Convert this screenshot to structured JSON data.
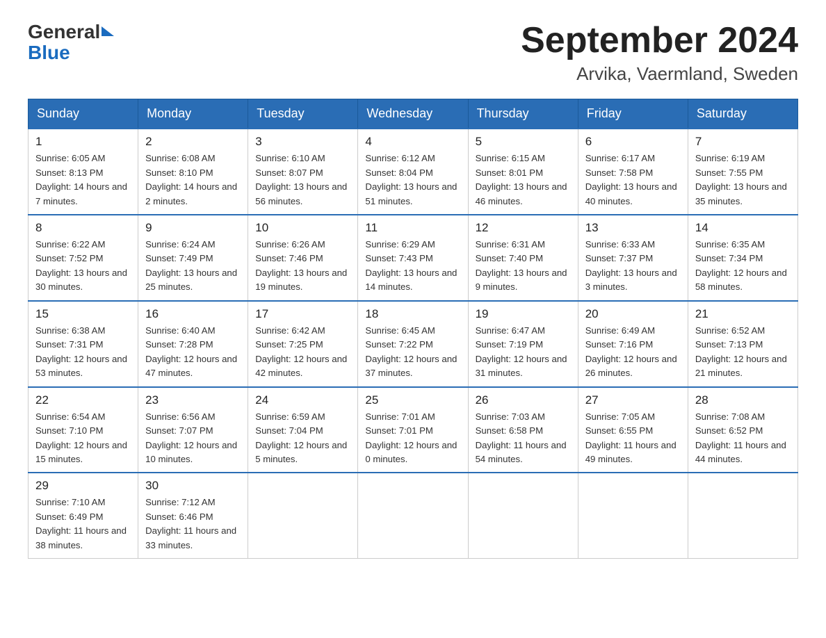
{
  "logo": {
    "text_general": "General",
    "text_blue": "Blue",
    "aria": "GeneralBlue logo"
  },
  "header": {
    "month_year": "September 2024",
    "location": "Arvika, Vaermland, Sweden"
  },
  "weekdays": [
    "Sunday",
    "Monday",
    "Tuesday",
    "Wednesday",
    "Thursday",
    "Friday",
    "Saturday"
  ],
  "weeks": [
    [
      {
        "day": "1",
        "sunrise": "6:05 AM",
        "sunset": "8:13 PM",
        "daylight": "14 hours and 7 minutes."
      },
      {
        "day": "2",
        "sunrise": "6:08 AM",
        "sunset": "8:10 PM",
        "daylight": "14 hours and 2 minutes."
      },
      {
        "day": "3",
        "sunrise": "6:10 AM",
        "sunset": "8:07 PM",
        "daylight": "13 hours and 56 minutes."
      },
      {
        "day": "4",
        "sunrise": "6:12 AM",
        "sunset": "8:04 PM",
        "daylight": "13 hours and 51 minutes."
      },
      {
        "day": "5",
        "sunrise": "6:15 AM",
        "sunset": "8:01 PM",
        "daylight": "13 hours and 46 minutes."
      },
      {
        "day": "6",
        "sunrise": "6:17 AM",
        "sunset": "7:58 PM",
        "daylight": "13 hours and 40 minutes."
      },
      {
        "day": "7",
        "sunrise": "6:19 AM",
        "sunset": "7:55 PM",
        "daylight": "13 hours and 35 minutes."
      }
    ],
    [
      {
        "day": "8",
        "sunrise": "6:22 AM",
        "sunset": "7:52 PM",
        "daylight": "13 hours and 30 minutes."
      },
      {
        "day": "9",
        "sunrise": "6:24 AM",
        "sunset": "7:49 PM",
        "daylight": "13 hours and 25 minutes."
      },
      {
        "day": "10",
        "sunrise": "6:26 AM",
        "sunset": "7:46 PM",
        "daylight": "13 hours and 19 minutes."
      },
      {
        "day": "11",
        "sunrise": "6:29 AM",
        "sunset": "7:43 PM",
        "daylight": "13 hours and 14 minutes."
      },
      {
        "day": "12",
        "sunrise": "6:31 AM",
        "sunset": "7:40 PM",
        "daylight": "13 hours and 9 minutes."
      },
      {
        "day": "13",
        "sunrise": "6:33 AM",
        "sunset": "7:37 PM",
        "daylight": "13 hours and 3 minutes."
      },
      {
        "day": "14",
        "sunrise": "6:35 AM",
        "sunset": "7:34 PM",
        "daylight": "12 hours and 58 minutes."
      }
    ],
    [
      {
        "day": "15",
        "sunrise": "6:38 AM",
        "sunset": "7:31 PM",
        "daylight": "12 hours and 53 minutes."
      },
      {
        "day": "16",
        "sunrise": "6:40 AM",
        "sunset": "7:28 PM",
        "daylight": "12 hours and 47 minutes."
      },
      {
        "day": "17",
        "sunrise": "6:42 AM",
        "sunset": "7:25 PM",
        "daylight": "12 hours and 42 minutes."
      },
      {
        "day": "18",
        "sunrise": "6:45 AM",
        "sunset": "7:22 PM",
        "daylight": "12 hours and 37 minutes."
      },
      {
        "day": "19",
        "sunrise": "6:47 AM",
        "sunset": "7:19 PM",
        "daylight": "12 hours and 31 minutes."
      },
      {
        "day": "20",
        "sunrise": "6:49 AM",
        "sunset": "7:16 PM",
        "daylight": "12 hours and 26 minutes."
      },
      {
        "day": "21",
        "sunrise": "6:52 AM",
        "sunset": "7:13 PM",
        "daylight": "12 hours and 21 minutes."
      }
    ],
    [
      {
        "day": "22",
        "sunrise": "6:54 AM",
        "sunset": "7:10 PM",
        "daylight": "12 hours and 15 minutes."
      },
      {
        "day": "23",
        "sunrise": "6:56 AM",
        "sunset": "7:07 PM",
        "daylight": "12 hours and 10 minutes."
      },
      {
        "day": "24",
        "sunrise": "6:59 AM",
        "sunset": "7:04 PM",
        "daylight": "12 hours and 5 minutes."
      },
      {
        "day": "25",
        "sunrise": "7:01 AM",
        "sunset": "7:01 PM",
        "daylight": "12 hours and 0 minutes."
      },
      {
        "day": "26",
        "sunrise": "7:03 AM",
        "sunset": "6:58 PM",
        "daylight": "11 hours and 54 minutes."
      },
      {
        "day": "27",
        "sunrise": "7:05 AM",
        "sunset": "6:55 PM",
        "daylight": "11 hours and 49 minutes."
      },
      {
        "day": "28",
        "sunrise": "7:08 AM",
        "sunset": "6:52 PM",
        "daylight": "11 hours and 44 minutes."
      }
    ],
    [
      {
        "day": "29",
        "sunrise": "7:10 AM",
        "sunset": "6:49 PM",
        "daylight": "11 hours and 38 minutes."
      },
      {
        "day": "30",
        "sunrise": "7:12 AM",
        "sunset": "6:46 PM",
        "daylight": "11 hours and 33 minutes."
      },
      null,
      null,
      null,
      null,
      null
    ]
  ],
  "labels": {
    "sunrise": "Sunrise:",
    "sunset": "Sunset:",
    "daylight": "Daylight:"
  }
}
